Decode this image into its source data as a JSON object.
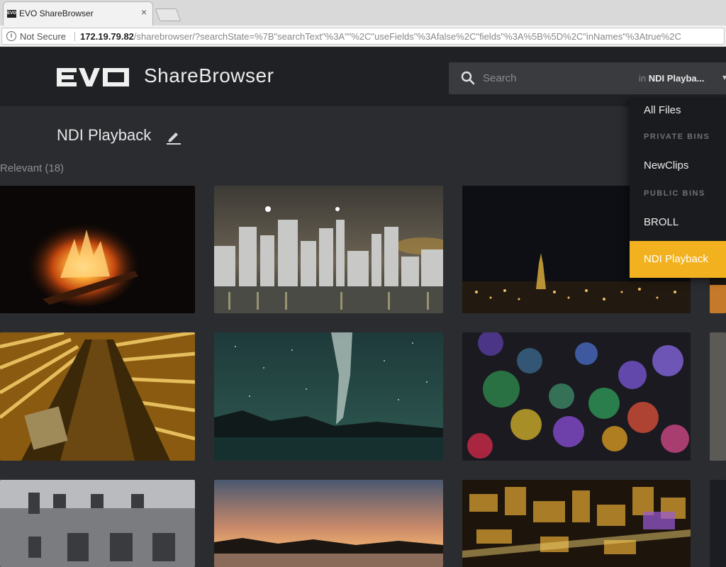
{
  "browser": {
    "tab_title": "EVO ShareBrowser",
    "favicon_text": "EVO",
    "tab_close": "×",
    "security_label": "Not Secure",
    "url_host": "172.19.79.82",
    "url_path": "/sharebrowser/?searchState=%7B\"searchText\"%3A\"\"%2C\"useFields\"%3Afalse%2C\"fields\"%3A%5B%5D%2C\"inNames\"%3Atrue%2C"
  },
  "header": {
    "brand": "ShareBrowser",
    "logo_text": "EVO",
    "search_placeholder": "Search",
    "scope_prefix": "in",
    "scope_value": "NDI Playba...",
    "scope_arrow": "▾"
  },
  "main": {
    "title": "NDI Playback",
    "result_label": "Relevant (18)"
  },
  "dropdown": {
    "all_files": "All Files",
    "private_bins_header": "PRIVATE BINS",
    "private_items": [
      "NewClips"
    ],
    "public_bins_header": "PUBLIC BINS",
    "public_items": [
      "BROLL",
      "NDI Playback"
    ],
    "accent_color": "#f2b21f"
  },
  "thumbnails": [
    {
      "subject": "campfire"
    },
    {
      "subject": "city-skyline-night"
    },
    {
      "subject": "empire-state-night"
    },
    {
      "subject": "golden-tower-up"
    },
    {
      "subject": "milky-way-lake"
    },
    {
      "subject": "bokeh-lights"
    },
    {
      "subject": "snowy-building"
    },
    {
      "subject": "sunset-lake"
    },
    {
      "subject": "city-aerial-night"
    }
  ],
  "colors": {
    "header_bg": "#202124",
    "content_bg": "#2b2c30",
    "accent": "#f2b21f"
  }
}
